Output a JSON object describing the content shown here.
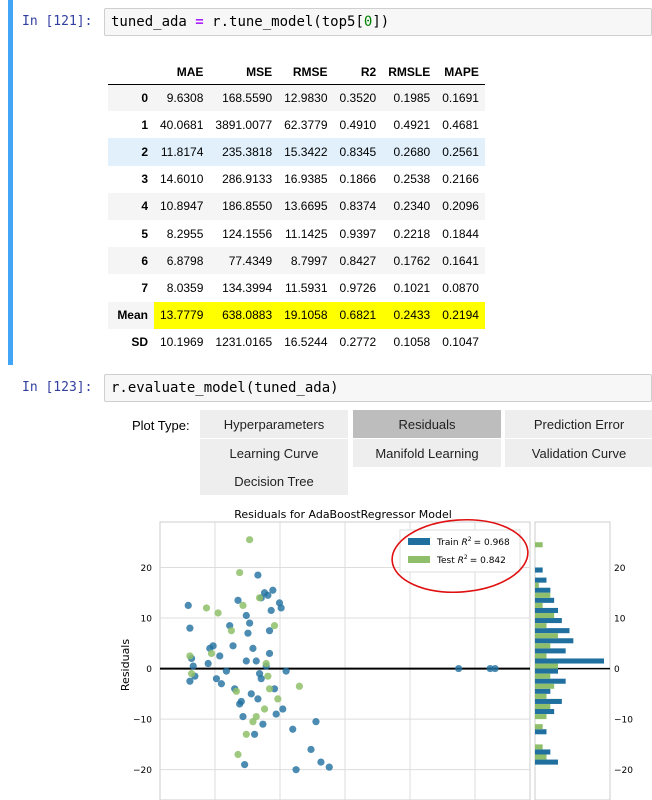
{
  "cell1": {
    "prompt": "In [121]:",
    "code": {
      "a": "tuned_ada ",
      "b": "=",
      "c": " r.tune_model(top5[",
      "d": "0",
      "e": "])"
    },
    "table": {
      "columns": [
        "MAE",
        "MSE",
        "RMSE",
        "R2",
        "RMSLE",
        "MAPE"
      ],
      "rows": [
        {
          "index": "0",
          "values": [
            "9.6308",
            "168.5590",
            "12.9830",
            "0.3520",
            "0.1985",
            "0.1691"
          ]
        },
        {
          "index": "1",
          "values": [
            "40.0681",
            "3891.0077",
            "62.3779",
            "0.4910",
            "0.4921",
            "0.4681"
          ]
        },
        {
          "index": "2",
          "values": [
            "11.8174",
            "235.3818",
            "15.3422",
            "0.8345",
            "0.2680",
            "0.2561"
          ]
        },
        {
          "index": "3",
          "values": [
            "14.6010",
            "286.9133",
            "16.9385",
            "0.1866",
            "0.2538",
            "0.2166"
          ]
        },
        {
          "index": "4",
          "values": [
            "10.8947",
            "186.8550",
            "13.6695",
            "0.8374",
            "0.2340",
            "0.2096"
          ]
        },
        {
          "index": "5",
          "values": [
            "8.2955",
            "124.1556",
            "11.1425",
            "0.9397",
            "0.2218",
            "0.1844"
          ]
        },
        {
          "index": "6",
          "values": [
            "6.8798",
            "77.4349",
            "8.7997",
            "0.8427",
            "0.1762",
            "0.1641"
          ]
        },
        {
          "index": "7",
          "values": [
            "8.0359",
            "134.3994",
            "11.5931",
            "0.9726",
            "0.1021",
            "0.0870"
          ]
        },
        {
          "index": "Mean",
          "values": [
            "13.7779",
            "638.0883",
            "19.1058",
            "0.6821",
            "0.2433",
            "0.2194"
          ]
        },
        {
          "index": "SD",
          "values": [
            "10.1969",
            "1231.0165",
            "16.5244",
            "0.2772",
            "0.1058",
            "0.1047"
          ]
        }
      ],
      "highlight_color": "#ffff00",
      "hover_color": "#e1f0fb"
    }
  },
  "cell2": {
    "prompt": "In [123]:",
    "code": "r.evaluate_model(tuned_ada)",
    "plot_type_label": "Plot Type:",
    "buttons": [
      {
        "label": "Hyperparameters",
        "active": false
      },
      {
        "label": "Residuals",
        "active": true
      },
      {
        "label": "Prediction Error",
        "active": false
      },
      {
        "label": "Learning Curve",
        "active": false
      },
      {
        "label": "Manifold Learning",
        "active": false
      },
      {
        "label": "Validation Curve",
        "active": false
      },
      {
        "label": "Decision Tree",
        "active": false
      }
    ]
  },
  "chart_data": {
    "type": "scatter",
    "title": "Residuals for AdaBoostRegressor Model",
    "xlabel": "",
    "ylabel": "Residuals",
    "ylim": [
      -26,
      29
    ],
    "y_ticks": [
      -20,
      -10,
      0,
      10,
      20
    ],
    "grid": true,
    "legend_placement": "top-right",
    "annotation": "red hand-drawn circle around legend",
    "colors": {
      "train": "#1f6f9f",
      "test": "#8fbf6a",
      "annotation": "#e01010"
    },
    "series": [
      {
        "name": "Train R^2 = 0.968",
        "legend_label": "Train",
        "legend_value": "= 0.968",
        "x": [
          0.1,
          0.2,
          0.3,
          0.2,
          0.5,
          1.3,
          1.8,
          2.0,
          2.6,
          2.8,
          2.4,
          1.6,
          3.1,
          3.6,
          3.7,
          3.3,
          3.4,
          2.9,
          4.0,
          4.5,
          3.8,
          4.2,
          4.7,
          5.1,
          4.9,
          5.2,
          4.4,
          3.9,
          4.8,
          5.0,
          5.3,
          5.6,
          5.4,
          4.1,
          3.5,
          6.0,
          7.8,
          8.1,
          8.6,
          4.6,
          4.3,
          5.7,
          6.4,
          7.5,
          6.6,
          5.8,
          4.5,
          5.0,
          16.4,
          18.3,
          18.6,
          3.2,
          2.1,
          0.4,
          1.4,
          4.3,
          3.6
        ],
        "y": [
          12.5,
          8.0,
          2.0,
          -2.5,
          -1.5,
          1.0,
          -2.0,
          2.5,
          8.5,
          4.5,
          -0.5,
          4.5,
          13.5,
          10.5,
          7.0,
          -6.5,
          -9.5,
          -4.0,
          4.0,
          14.0,
          9.0,
          1.5,
          15.0,
          11.5,
          14.5,
          15.5,
          -1.0,
          -5.0,
          0.5,
          3.0,
          -4.0,
          13.0,
          -9.0,
          -13.0,
          -19.0,
          -0.5,
          -10.5,
          -18.5,
          -19.5,
          -11.0,
          18.5,
          12.0,
          -12.0,
          -16.0,
          -20.0,
          -8.0,
          -2.0,
          7.5,
          0.0,
          0.0,
          0.0,
          -7.0,
          -3.0,
          0.5,
          4.0,
          -6.0,
          1.5
        ]
      },
      {
        "name": "Test R^2 = 0.842",
        "legend_label": "Test",
        "legend_value": "= 0.842",
        "x": [
          0.2,
          1.2,
          1.9,
          2.7,
          3.2,
          3.8,
          4.4,
          5.0,
          5.5,
          6.8,
          3.6,
          4.7,
          4.2,
          3.1,
          5.3,
          4.9,
          0.3,
          1.5,
          3.0,
          4.0,
          4.8,
          3.4
        ],
        "y": [
          2.5,
          12.0,
          11.0,
          7.5,
          19.0,
          25.5,
          14.0,
          -4.0,
          -6.0,
          -3.5,
          -13.0,
          -8.0,
          -9.5,
          -17.0,
          8.5,
          -1.5,
          -1.0,
          3.0,
          -4.5,
          -10.5,
          1.0,
          12.5
        ]
      }
    ],
    "histograms": {
      "bins_y": [
        -20,
        -18,
        -16,
        -14,
        -12,
        -10,
        -8,
        -6,
        -4,
        -2,
        0,
        2,
        4,
        6,
        8,
        10,
        12,
        14,
        16,
        18,
        20,
        22,
        24
      ],
      "train": [
        6,
        4,
        0,
        3,
        0,
        5,
        7,
        4,
        8,
        6,
        18,
        8,
        10,
        9,
        7,
        6,
        5,
        4,
        3,
        2,
        0,
        0,
        0
      ],
      "test": [
        0,
        3,
        2,
        0,
        2,
        3,
        4,
        3,
        5,
        4,
        6,
        3,
        4,
        6,
        3,
        5,
        2,
        4,
        1,
        0,
        0,
        0,
        2
      ]
    }
  }
}
